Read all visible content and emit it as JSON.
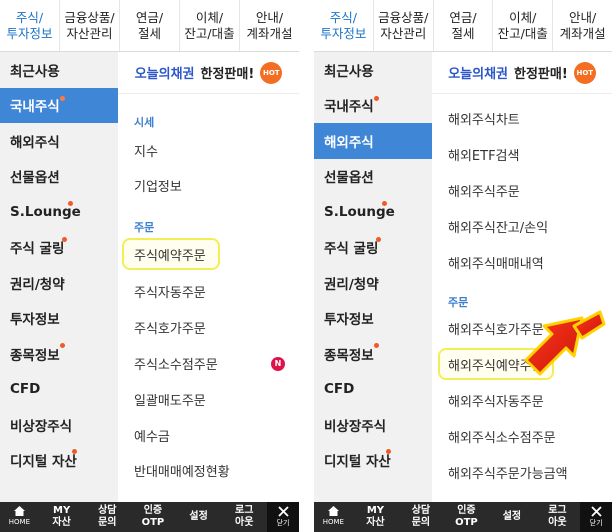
{
  "tabs": [
    {
      "line1": "주식/",
      "line2": "투자정보"
    },
    {
      "line1": "금융상품/",
      "line2": "자산관리"
    },
    {
      "line1": "연금/",
      "line2": "절세"
    },
    {
      "line1": "이체/",
      "line2": "잔고/대출"
    },
    {
      "line1": "안내/",
      "line2": "계좌개설"
    }
  ],
  "sidebar": [
    "최근사용",
    "국내주식",
    "해외주식",
    "선물옵션",
    "S.Lounge",
    "주식 굴링",
    "권리/청약",
    "투자정보",
    "종목정보",
    "CFD",
    "비상장주식",
    "디지털 자산"
  ],
  "banner": {
    "highlight": "오늘의채권",
    "rest": "한정판매!",
    "badge": "HOT"
  },
  "left_content": {
    "section1": "시세",
    "items1": [
      "지수",
      "기업정보"
    ],
    "section2": "주문",
    "items2": [
      "주식예약주문",
      "주식자동주문",
      "주식호가주문",
      "주식소수점주문",
      "일괄매도주문",
      "예수금",
      "반대매매예정현황"
    ],
    "new_badge": "N"
  },
  "right_content": {
    "items1": [
      "해외주식차트",
      "해외ETF검색",
      "해외주식주문",
      "해외주식잔고/손익",
      "해외주식매매내역"
    ],
    "section2": "주문",
    "items2": [
      "해외주식호가주문",
      "해외주식예약주문",
      "해외주식자동주문",
      "해외주식소수점주문",
      "해외주식주문가능금액"
    ]
  },
  "bottom": [
    {
      "l1": "",
      "l2": "HOME"
    },
    {
      "l1": "MY",
      "l2": "자산"
    },
    {
      "l1": "상담",
      "l2": "문의"
    },
    {
      "l1": "인증",
      "l2": "OTP"
    },
    {
      "l1": "설정",
      "l2": ""
    },
    {
      "l1": "로그",
      "l2": "아웃"
    },
    {
      "l1": "",
      "l2": "닫기"
    }
  ],
  "colors": {
    "accent": "#3f87d6",
    "highlight_box": "#f4ee56",
    "arrow": "#e8281a",
    "dot": "#ef5a2a"
  }
}
